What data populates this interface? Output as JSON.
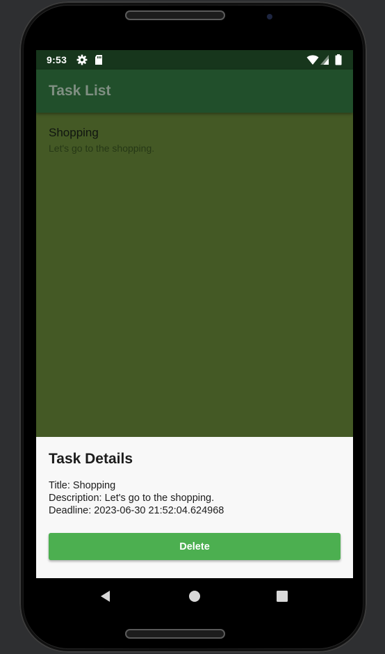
{
  "status_bar": {
    "time": "9:53",
    "left_icons": [
      "gear-icon",
      "sd-card-icon"
    ],
    "right_icons": [
      "wifi-icon",
      "signal-icon",
      "battery-icon"
    ]
  },
  "app_bar": {
    "title": "Task List"
  },
  "tasks": [
    {
      "title": "Shopping",
      "description": "Let's go to the shopping."
    }
  ],
  "bottom_sheet": {
    "title": "Task Details",
    "title_line": "Title: Shopping",
    "description_line": "Description: Let's go to the shopping.",
    "deadline_line": "Deadline: 2023-06-30 21:52:04.624968",
    "delete_label": "Delete"
  },
  "nav_bar": {
    "buttons": [
      "back-icon",
      "home-icon",
      "recents-icon"
    ]
  },
  "colors": {
    "status_bar": "#17361c",
    "app_bar": "#214f2b",
    "scrim_list": "#445925",
    "sheet_bg": "#f8f8f8",
    "delete_button": "#4caf50"
  }
}
